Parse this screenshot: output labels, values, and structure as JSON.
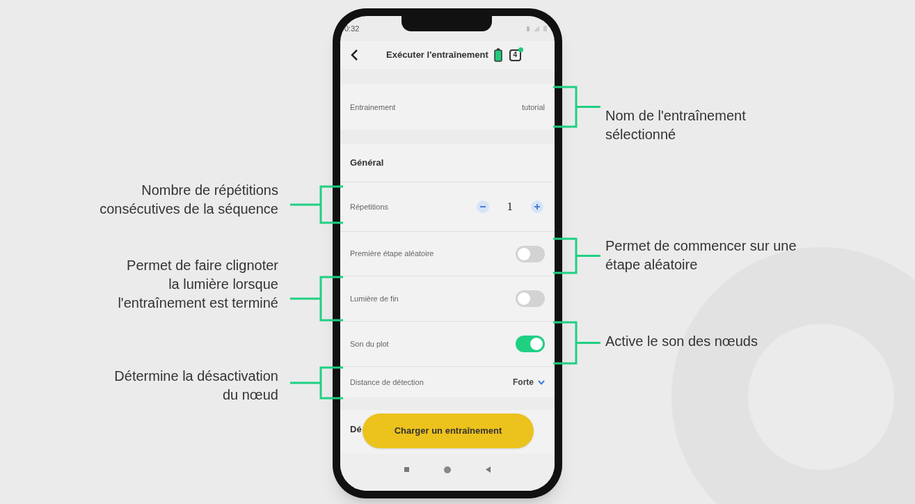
{
  "status_bar": {
    "time": "0:32"
  },
  "header": {
    "title": "Exécuter l'entraînement",
    "device_count": "4"
  },
  "training": {
    "label": "Entrainement",
    "value": "tutorial"
  },
  "section": "Général",
  "settings": [
    {
      "kind": "stepper",
      "label": "Répetitions",
      "value": "1"
    },
    {
      "kind": "toggle",
      "label": "Première étape aléatoire",
      "on": false
    },
    {
      "kind": "toggle",
      "label": "Lumière de fin",
      "on": false
    },
    {
      "kind": "toggle",
      "label": "Son du plot",
      "on": true
    },
    {
      "kind": "select",
      "label": "Distance de détection",
      "value": "Forte"
    }
  ],
  "next_section_partial": "Dé",
  "load_button": "Charger un entraînement",
  "left_callouts": [
    {
      "lines": [
        "Nombre de répétitions",
        "consécutives de la séquence"
      ]
    },
    {
      "lines": [
        "Permet de faire clignoter",
        "la lumière lorsque",
        "l'entraînement est terminé"
      ]
    },
    {
      "lines": [
        "Détermine la désactivation",
        "du nœud"
      ]
    }
  ],
  "right_callouts": [
    {
      "lines": [
        "Nom de l'entraînement",
        "sélectionné"
      ]
    },
    {
      "lines": [
        "Permet de commencer sur une",
        "étape aléatoire"
      ]
    },
    {
      "lines": [
        "Active le son des nœuds"
      ]
    }
  ]
}
